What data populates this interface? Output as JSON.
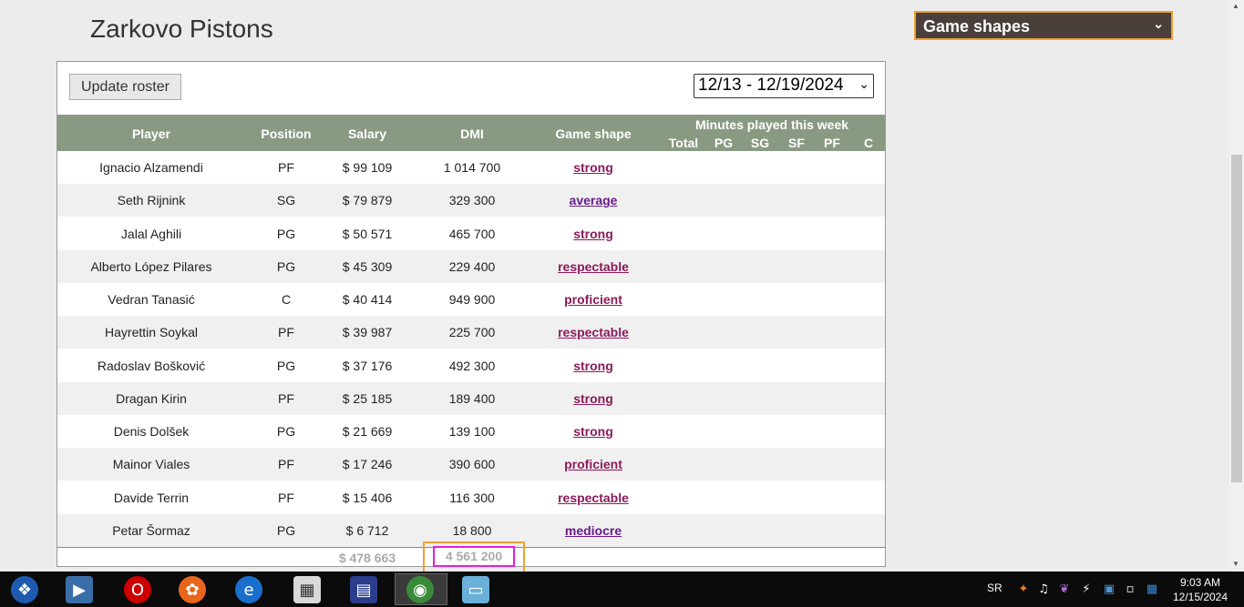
{
  "page_title": "Zarkovo Pistons",
  "game_shapes_dropdown": "Game shapes",
  "update_button": "Update roster",
  "week_select": "12/13 - 12/19/2024",
  "headers": {
    "player": "Player",
    "position": "Position",
    "salary": "Salary",
    "dmi": "DMI",
    "game_shape": "Game shape",
    "minutes_title": "Minutes played this week",
    "minutes_sub": [
      "Total",
      "PG",
      "SG",
      "SF",
      "PF",
      "C"
    ]
  },
  "rows": [
    {
      "player": "Ignacio Alzamendi",
      "position": "PF",
      "salary": "$ 99 109",
      "dmi": "1 014 700",
      "shape": "strong"
    },
    {
      "player": "Seth Rijnink",
      "position": "SG",
      "salary": "$ 79 879",
      "dmi": "329 300",
      "shape": "average"
    },
    {
      "player": "Jalal Aghili",
      "position": "PG",
      "salary": "$ 50 571",
      "dmi": "465 700",
      "shape": "strong"
    },
    {
      "player": "Alberto López Pilares",
      "position": "PG",
      "salary": "$ 45 309",
      "dmi": "229 400",
      "shape": "respectable"
    },
    {
      "player": "Vedran Tanasić",
      "position": "C",
      "salary": "$ 40 414",
      "dmi": "949 900",
      "shape": "proficient"
    },
    {
      "player": "Hayrettin Soykal",
      "position": "PF",
      "salary": "$ 39 987",
      "dmi": "225 700",
      "shape": "respectable"
    },
    {
      "player": "Radoslav Bošković",
      "position": "PG",
      "salary": "$ 37 176",
      "dmi": "492 300",
      "shape": "strong"
    },
    {
      "player": "Dragan Kirin",
      "position": "PF",
      "salary": "$ 25 185",
      "dmi": "189 400",
      "shape": "strong"
    },
    {
      "player": "Denis Dolšek",
      "position": "PG",
      "salary": "$ 21 669",
      "dmi": "139 100",
      "shape": "strong"
    },
    {
      "player": "Mainor Viales",
      "position": "PF",
      "salary": "$ 17 246",
      "dmi": "390 600",
      "shape": "proficient"
    },
    {
      "player": "Davide Terrin",
      "position": "PF",
      "salary": "$ 15 406",
      "dmi": "116 300",
      "shape": "respectable"
    },
    {
      "player": "Petar Šormaz",
      "position": "PG",
      "salary": "$ 6 712",
      "dmi": "18 800",
      "shape": "mediocre"
    }
  ],
  "totals": {
    "salary": "$ 478 663",
    "dmi": "4 561 200"
  },
  "colors": {
    "header_bg": "#8a9a82",
    "shape_link": "#8b1a5a",
    "highlight_orange": "#f0a030",
    "highlight_magenta": "#e020e0"
  },
  "taskbar": {
    "apps": [
      "windows-start-icon",
      "media-player-icon",
      "opera-icon",
      "firefox-icon",
      "internet-explorer-icon",
      "calculator-icon",
      "save-disk-icon",
      "chrome-icon",
      "blue-app-icon"
    ],
    "language": "SR",
    "time": "9:03 AM",
    "date": "12/15/2024"
  }
}
